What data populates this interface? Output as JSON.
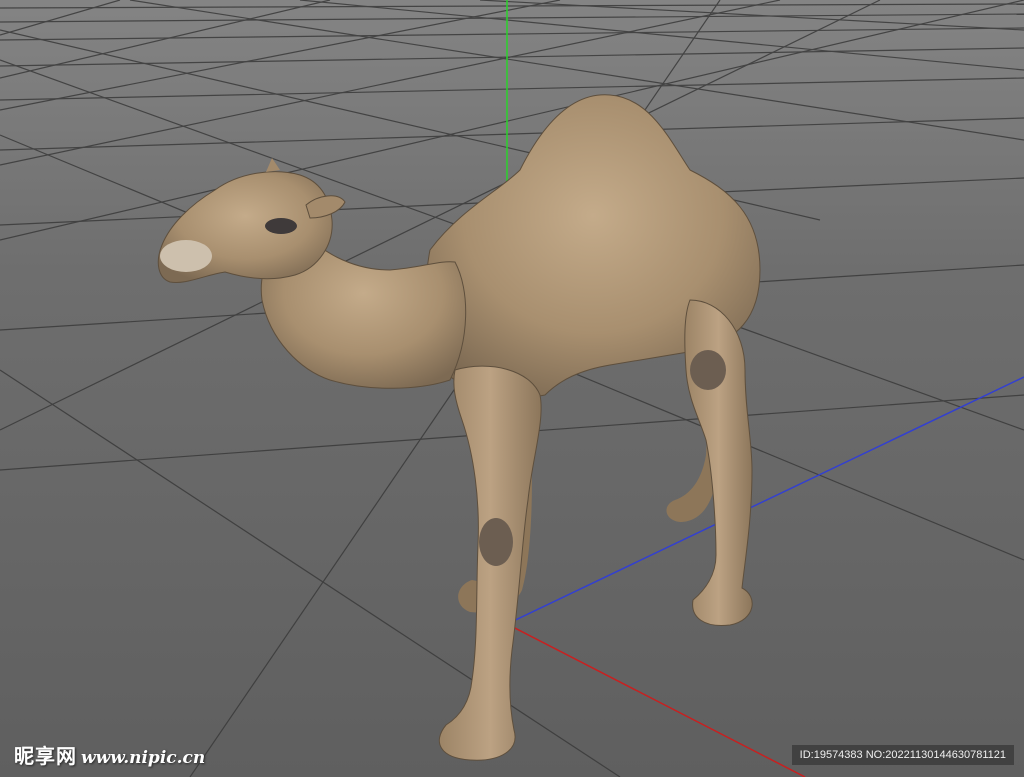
{
  "viewport": {
    "background_color": "#6b6b6b",
    "grid_color": "#3a3a3a",
    "axes": {
      "y_axis_color": "#2bd12b",
      "z_axis_color": "#3340d0",
      "x_axis_color": "#c82020"
    }
  },
  "model": {
    "name_icon": "camel-model",
    "body_color": "#b39a7a"
  },
  "watermark": {
    "logo_text": "昵享网",
    "site_text": "www.nipic.cn",
    "id_text": "ID:19574383 NO:20221130144630781121"
  }
}
